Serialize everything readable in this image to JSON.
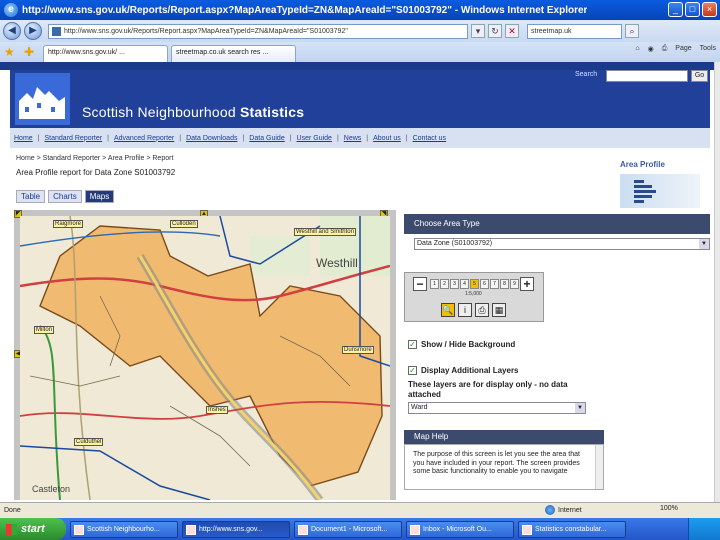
{
  "browser": {
    "window_title": "http://www.sns.gov.uk/Reports/Report.aspx?MapAreaTypeId=ZN&MapAreaId=\"S01003792\" - Windows Internet Explorer",
    "address": "http://www.sns.gov.uk/Reports/Report.aspx?MapAreaTypeId=ZN&MapAreaId=\"S01003792\"",
    "search_value": "streetmap.uk",
    "tabs": [
      "http://www.sns.gov.uk/ ...",
      "streetmap.co.uk search res ..."
    ],
    "tools": {
      "page": "Page",
      "tools": "Tools"
    }
  },
  "site": {
    "brand_light": "Scottish Neighbourhood ",
    "brand_bold": "Statistics",
    "search_label": "Search",
    "go_label": "Go",
    "nav": [
      "Home",
      "Standard Reporter",
      "Advanced Reporter",
      "Data Downloads",
      "Data Guide",
      "User Guide",
      "News",
      "About us",
      "Contact us"
    ],
    "nav_sep": "|",
    "breadcrumb": "Home > Standard Reporter > Area Profile > Report",
    "report_title": "Area Profile report for Data Zone S01003792",
    "area_profile_label": "Area Profile",
    "subtabs": [
      "Table",
      "Charts",
      "Maps"
    ]
  },
  "map": {
    "labels": {
      "raigmore": "Raigmore",
      "culloden": "Culloden",
      "westhill": "Westhill and Smithton",
      "inshes": "Inshes",
      "milton": "Milton",
      "dunsmore": "Dunsmore",
      "culduthel": "Culduthel",
      "westhill_big": "Westhill",
      "castleton": "Castleton"
    }
  },
  "panel": {
    "choose_header": "Choose Area Type",
    "choose_value": "Data Zone (S01003792)",
    "zoom_steps": [
      "1",
      "2",
      "3",
      "4",
      "5",
      "6",
      "7",
      "8",
      "9"
    ],
    "zoom_selected_step": "5",
    "zoom_caption": "1:5,000",
    "show_hide": "Show / Hide Background",
    "display_layers": "Display Additional Layers",
    "layers_note": "These layers are for display only - no data attached",
    "layers_value": "Ward",
    "help_header": "Map Help",
    "help_text": "The purpose of this screen is let you see the area that you have included in your report. The screen provides some basic functionality to enable you to navigate"
  },
  "status": {
    "left": "Done",
    "zone": "Internet",
    "zoom": "100%"
  },
  "taskbar": {
    "start": "start",
    "items": [
      "Scottish Neighbourho...",
      "http://www.sns.gov...",
      "Document1 - Microsoft...",
      "Inbox - Microsoft Ou...",
      "Statistics constabular..."
    ]
  },
  "colors": {
    "banner": "#20409a",
    "map_area_fill": "#f2b05a",
    "panel_header": "#3c4a6e"
  }
}
